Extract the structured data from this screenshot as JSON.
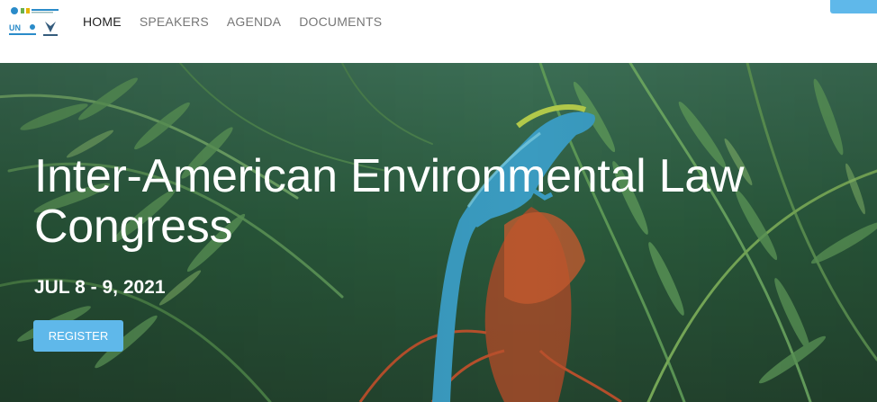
{
  "nav": {
    "items": [
      {
        "label": "HOME",
        "active": true
      },
      {
        "label": "SPEAKERS",
        "active": false
      },
      {
        "label": "AGENDA",
        "active": false
      },
      {
        "label": "DOCUMENTS",
        "active": false
      }
    ]
  },
  "logo": {
    "text": "UN"
  },
  "hero": {
    "title": "Inter-American Environmental Law Congress",
    "date": "JUL 8 - 9, 2021",
    "register_label": "REGISTER"
  },
  "colors": {
    "accent": "#5fb8ea",
    "foliage_dark": "#1f4a32",
    "foliage_light": "#5f9b5c",
    "lizard": "#3a9bc0",
    "flower": "#b5542c"
  }
}
